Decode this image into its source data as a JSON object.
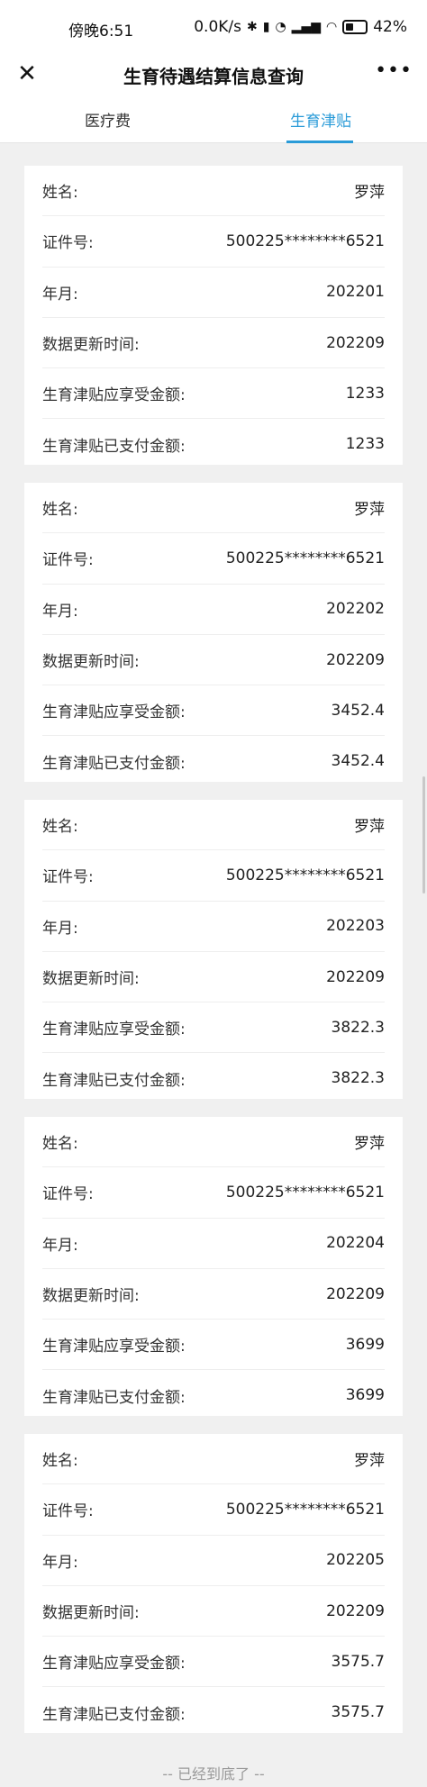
{
  "status_bar": {
    "time": "傍晚6:51",
    "speed": "0.0K/s",
    "battery": "42%"
  },
  "nav": {
    "close_icon": "close-icon",
    "title": "生育待遇结算信息查询",
    "more_icon": "more-icon"
  },
  "tabs": [
    {
      "label": "医疗费"
    },
    {
      "label": "生育津贴"
    }
  ],
  "accent_color": "#2a9bd8",
  "field_labels": {
    "name": "姓名:",
    "id": "证件号:",
    "ym": "年月:",
    "update": "数据更新时间:",
    "due": "生育津贴应享受金额:",
    "paid": "生育津贴已支付金额:"
  },
  "records": [
    {
      "name": "罗萍",
      "id": "500225********6521",
      "ym": "202201",
      "update": "202209",
      "due": "1233",
      "paid": "1233"
    },
    {
      "name": "罗萍",
      "id": "500225********6521",
      "ym": "202202",
      "update": "202209",
      "due": "3452.4",
      "paid": "3452.4"
    },
    {
      "name": "罗萍",
      "id": "500225********6521",
      "ym": "202203",
      "update": "202209",
      "due": "3822.3",
      "paid": "3822.3"
    },
    {
      "name": "罗萍",
      "id": "500225********6521",
      "ym": "202204",
      "update": "202209",
      "due": "3699",
      "paid": "3699"
    },
    {
      "name": "罗萍",
      "id": "500225********6521",
      "ym": "202205",
      "update": "202209",
      "due": "3575.7",
      "paid": "3575.7"
    }
  ],
  "bottom_note": "-- 已经到底了 --"
}
